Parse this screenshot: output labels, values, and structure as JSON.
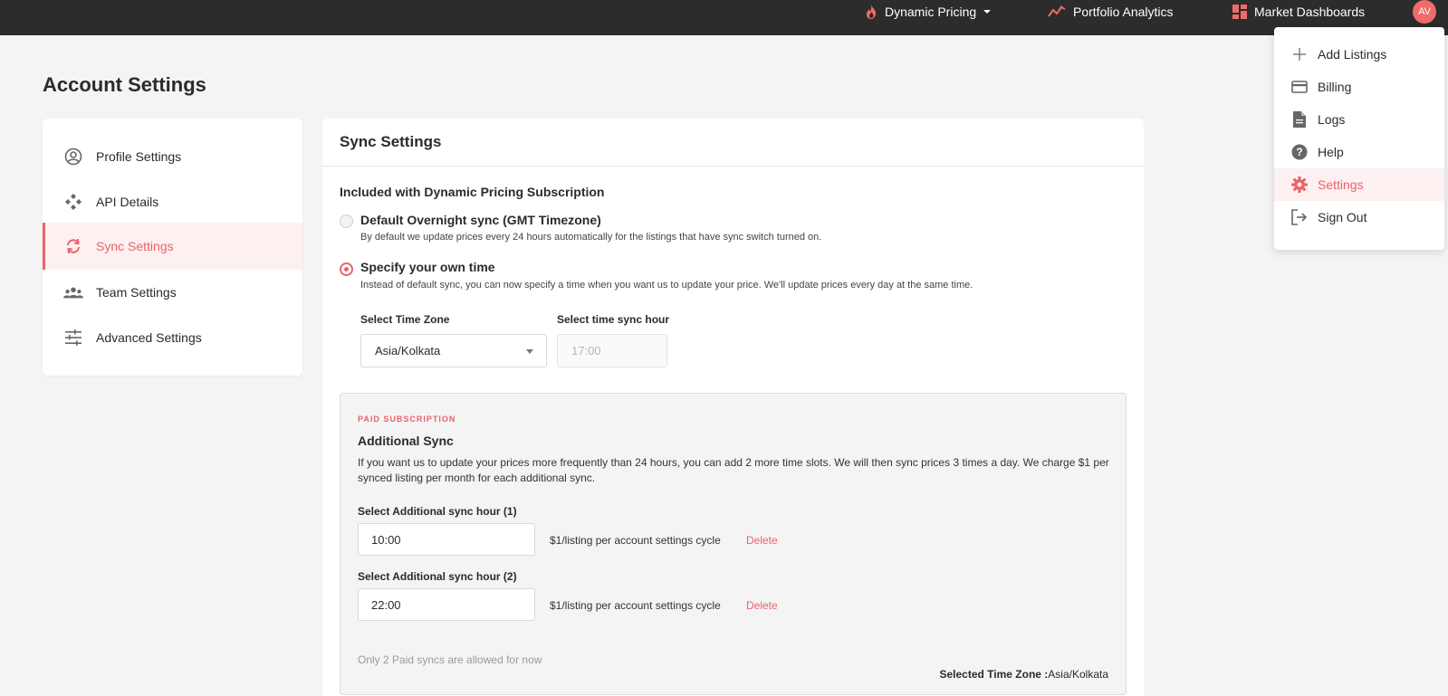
{
  "nav": {
    "dynamic_pricing": "Dynamic Pricing",
    "portfolio_analytics": "Portfolio Analytics",
    "market_dashboards": "Market Dashboards",
    "avatar_initials": "AV"
  },
  "user_menu": {
    "items": [
      {
        "label": "Add Listings",
        "icon": "plus-icon"
      },
      {
        "label": "Billing",
        "icon": "credit-card-icon"
      },
      {
        "label": "Logs",
        "icon": "document-icon"
      },
      {
        "label": "Help",
        "icon": "help-icon"
      },
      {
        "label": "Settings",
        "icon": "gear-icon",
        "active": true
      },
      {
        "label": "Sign Out",
        "icon": "sign-out-icon"
      }
    ]
  },
  "page_title": "Account Settings",
  "sidebar": {
    "items": [
      {
        "label": "Profile Settings",
        "icon": "user-circle-icon"
      },
      {
        "label": "API Details",
        "icon": "api-icon"
      },
      {
        "label": "Sync Settings",
        "icon": "sync-icon",
        "active": true
      },
      {
        "label": "Team Settings",
        "icon": "team-icon"
      },
      {
        "label": "Advanced Settings",
        "icon": "sliders-icon"
      }
    ]
  },
  "sync": {
    "header": "Sync Settings",
    "section_label": "Included with Dynamic Pricing Subscription",
    "option_default": {
      "label": "Default Overnight sync (GMT Timezone)",
      "description": "By default we update prices every 24 hours automatically for the listings that have sync switch turned on.",
      "selected": false
    },
    "option_custom": {
      "label": "Specify your own time",
      "description": "Instead of default sync, you can now specify a time when you want us to update your price. We'll update prices every day at the same time.",
      "selected": true
    },
    "timezone_label": "Select Time Zone",
    "timezone_value": "Asia/Kolkata",
    "sync_hour_label": "Select time sync hour",
    "sync_hour_value": "17:00"
  },
  "paid": {
    "tag": "PAID SUBSCRIPTION",
    "title": "Additional Sync",
    "description": "If you want us to update your prices more frequently than 24 hours, you can add 2 more time slots. We will then sync prices 3 times a day. We charge $1 per synced listing per month for each additional sync.",
    "slots": [
      {
        "label": "Select Additional sync hour (1)",
        "value": "10:00",
        "price": "$1/listing per account settings cycle",
        "delete": "Delete"
      },
      {
        "label": "Select Additional sync hour (2)",
        "value": "22:00",
        "price": "$1/listing per account settings cycle",
        "delete": "Delete"
      }
    ],
    "note": "Only 2 Paid syncs are allowed for now",
    "tz_summary_label": "Selected Time Zone :",
    "tz_summary_value": "Asia/Kolkata"
  },
  "colors": {
    "accent": "#e8646b",
    "topbar": "#2c2c2c",
    "background": "#f4f4f5"
  }
}
